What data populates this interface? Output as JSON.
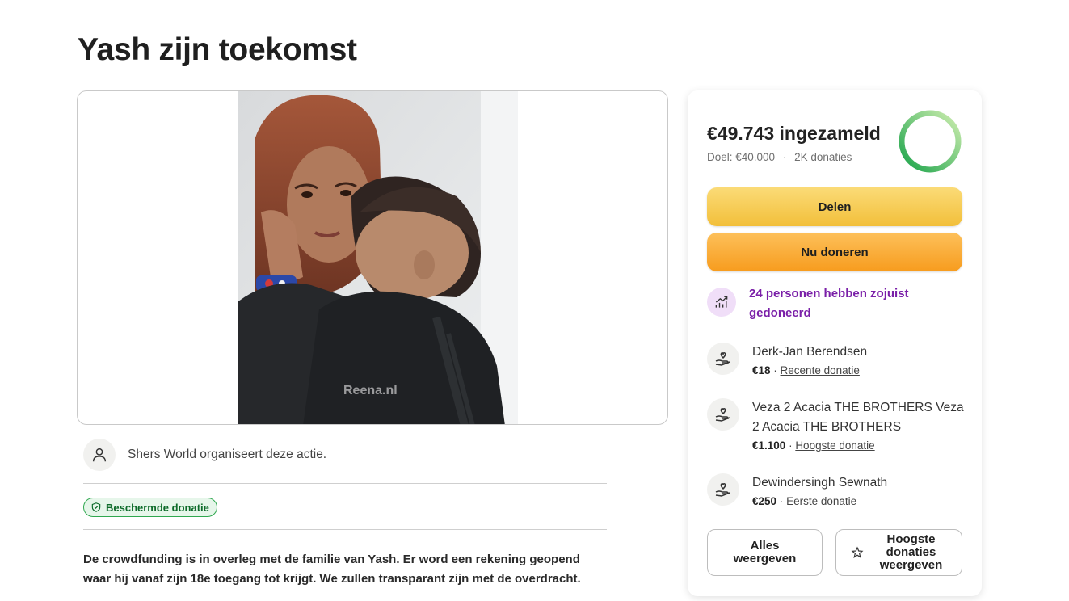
{
  "page": {
    "title": "Yash zijn toekomst"
  },
  "media": {
    "watermark": "Reena.nl"
  },
  "organizer": {
    "text": "Shers World organiseert deze actie."
  },
  "badge": {
    "label": "Beschermde donatie"
  },
  "description": {
    "line1": "De crowdfunding is in overleg met de familie van Yash. Er word een rekening geopend",
    "line2": "waar hij vanaf zijn 18e toegang tot krijgt. We zullen transparant zijn met de overdracht."
  },
  "fundraiser": {
    "raised": "€49.743 ingezameld",
    "goal": "Doel: €40.000",
    "separator": "·",
    "donations_count": "2K donaties",
    "progress_fraction": 1.0,
    "progress_color": "#2fb350",
    "share_label": "Delen",
    "donate_label": "Nu doneren",
    "trend_text": "24 personen hebben zojuist gedoneerd",
    "donors": [
      {
        "name": "Derk-Jan Berendsen",
        "amount": "€18",
        "type": "Recente donatie"
      },
      {
        "name": "Veza 2 Acacia THE BROTHERS Veza 2 Acacia THE BROTHERS",
        "amount": "€1.100",
        "type": "Hoogste donatie"
      },
      {
        "name": "Dewindersingh Sewnath",
        "amount": "€250",
        "type": "Eerste donatie"
      }
    ],
    "see_all_label": "Alles weergeven",
    "see_top_label": "Hoogste donaties weergeven"
  },
  "colors": {
    "share_button": "#f5c84d",
    "donate_button": "#f9a532",
    "trend_text": "#7a1fa8",
    "badge_border": "#2fa84f"
  },
  "icons": {
    "organizer": "user-icon",
    "badge": "shield-icon",
    "trend": "trending-up-icon",
    "donor": "heart-hand-icon",
    "top": "star-icon"
  }
}
